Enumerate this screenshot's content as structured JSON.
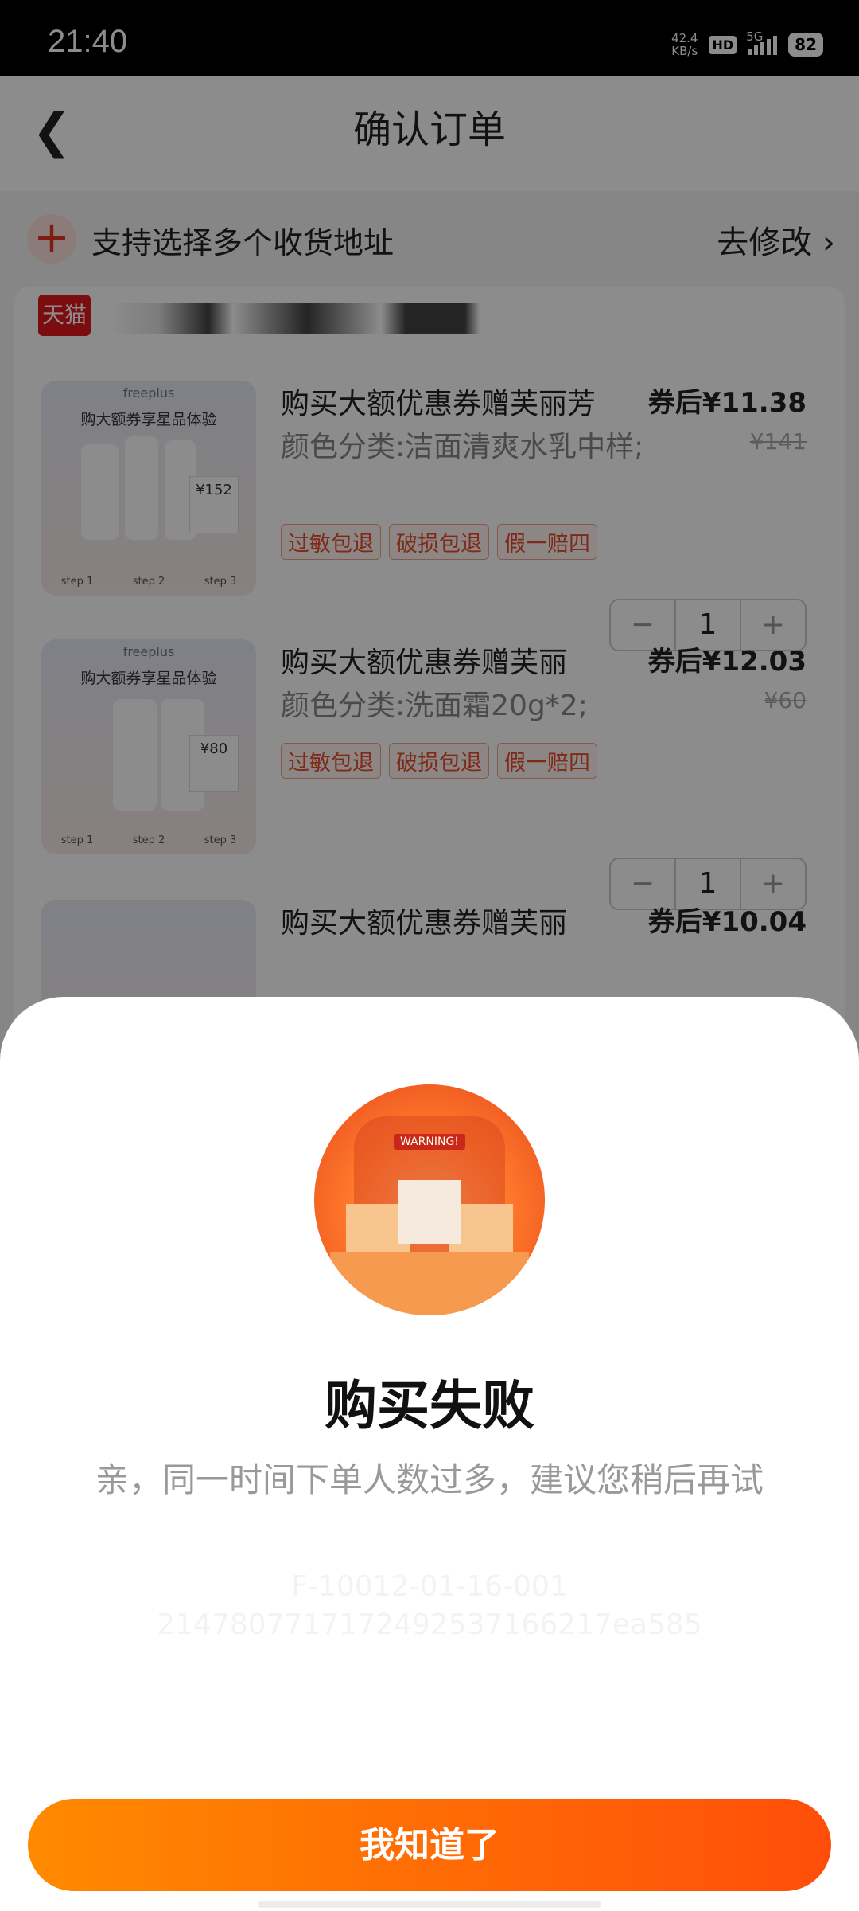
{
  "status_bar": {
    "time": "21:40",
    "net_speed": "42.4",
    "net_unit": "KB/s",
    "hd": "HD",
    "network": "5G",
    "battery": "82"
  },
  "header": {
    "title": "确认订单"
  },
  "address": {
    "text": "支持选择多个收货地址",
    "edit": "去修改"
  },
  "shop": {
    "logo": "天猫"
  },
  "items": [
    {
      "name": "购买大额优惠券赠芙丽芳",
      "spec": "颜色分类:洁面清爽水乳中样;",
      "tags": [
        "过敏包退",
        "破损包退",
        "假一赔四"
      ],
      "price": "券后¥11.38",
      "orig": "¥141",
      "qty": "1",
      "thumb": {
        "brand": "freeplus",
        "promo": "购大额券享星品体验",
        "coupon": "¥152"
      }
    },
    {
      "name": "购买大额优惠券赠芙丽",
      "spec": "颜色分类:洗面霜20g*2;",
      "tags": [
        "过敏包退",
        "破损包退",
        "假一赔四"
      ],
      "price": "券后¥12.03",
      "orig": "¥60",
      "qty": "1",
      "thumb": {
        "brand": "freeplus",
        "promo": "购大额券享星品体验",
        "coupon": "¥80"
      }
    },
    {
      "name": "购买大额优惠券赠芙丽",
      "price": "券后¥10.04"
    }
  ],
  "stepper": {
    "minus": "−",
    "plus": "+"
  },
  "dialog": {
    "illustration_label": "WARNING!",
    "title": "购买失败",
    "message": "亲，同一时间下单人数过多，建议您稍后再试",
    "code1": "F-10012-01-16-001",
    "code2": "2147807717172492537166217ea585",
    "button": "我知道了"
  }
}
